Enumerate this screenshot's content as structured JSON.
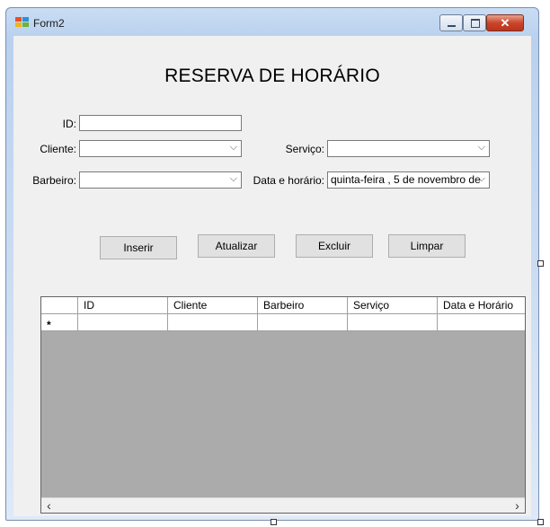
{
  "window": {
    "title": "Form2"
  },
  "form": {
    "heading": "RESERVA DE HORÁRIO",
    "id_label": "ID:",
    "id_value": "",
    "cliente_label": "Cliente:",
    "cliente_value": "",
    "barbeiro_label": "Barbeiro:",
    "barbeiro_value": "",
    "servico_label": "Serviço:",
    "servico_value": "",
    "data_label": "Data e horário:",
    "data_value": "quinta-feira ,  5 de novembro de"
  },
  "buttons": {
    "inserir": "Inserir",
    "atualizar": "Atualizar",
    "excluir": "Excluir",
    "limpar": "Limpar"
  },
  "grid": {
    "columns": [
      "ID",
      "Cliente",
      "Barbeiro",
      "Serviço",
      "Data e Horário"
    ],
    "new_row_marker": "*",
    "rows": []
  },
  "icons": {
    "app": "windows-forms-icon",
    "minimize": "minimize-icon",
    "maximize": "maximize-icon",
    "close": "close-icon",
    "dropdown": "chevron-down-icon",
    "scroll_left": "chevron-left-icon",
    "scroll_right": "chevron-right-icon"
  },
  "glyphs": {
    "chevron_down": "⌵",
    "scroll_left": "‹",
    "scroll_right": "›"
  }
}
